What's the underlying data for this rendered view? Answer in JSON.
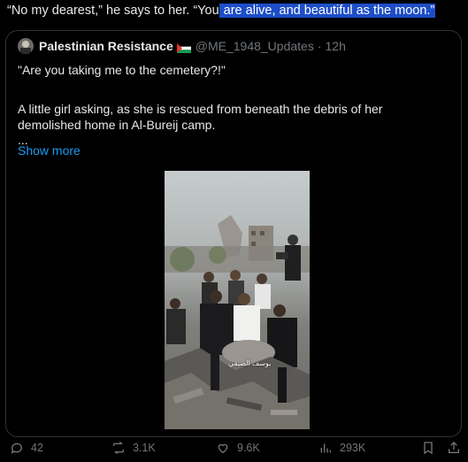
{
  "post": {
    "text_before": "“No my dearest,” he says to her. “You",
    "text_highlighted": " are alive, and beautiful as the moon.”"
  },
  "quoted_post": {
    "author_name": "Palestinian Resistance",
    "author_handle": "@ME_1948_Updates",
    "separator": "·",
    "time": "12h",
    "line1": "\"Are you taking me to the cemetery?!\"",
    "paragraph": "A little girl asking, as she is rescued from beneath the debris of her demolished home in Al-Bureij camp.",
    "ellipsis": "...",
    "show_more": "Show more",
    "video_watermark": "يوسف الصيفي"
  },
  "actions": {
    "replies": "42",
    "reposts": "3.1K",
    "likes": "9.6K",
    "views": "293K"
  },
  "colors": {
    "background": "#000000",
    "text": "#e7e9ea",
    "muted": "#71767b",
    "link": "#1d9bf0",
    "selection": "#1d4ec8",
    "border": "#2f3336"
  },
  "icons": [
    "reply-icon",
    "repost-icon",
    "like-icon",
    "views-icon",
    "bookmark-icon",
    "share-icon",
    "flag-icon"
  ]
}
